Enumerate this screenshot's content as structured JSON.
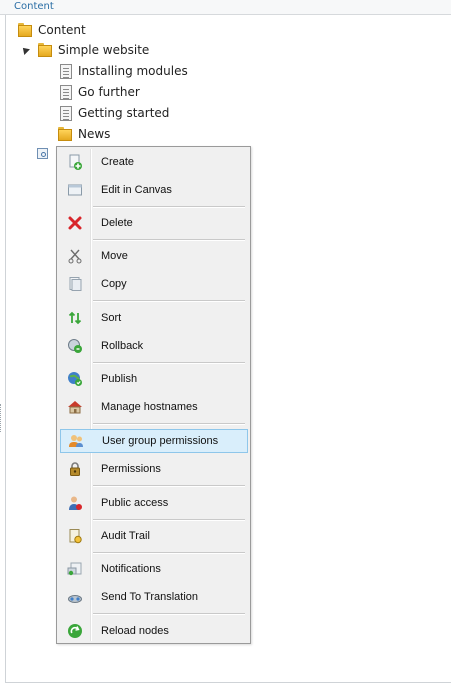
{
  "header": {
    "title": "Content"
  },
  "tree": {
    "root": {
      "label": "Content"
    },
    "site": {
      "label": "Simple website"
    },
    "pages": [
      {
        "label": "Installing modules"
      },
      {
        "label": "Go further"
      },
      {
        "label": "Getting started"
      }
    ],
    "news": {
      "label": "News"
    }
  },
  "context_menu": {
    "items": [
      {
        "label": "Create",
        "icon": "create-icon"
      },
      {
        "label": "Edit in Canvas",
        "icon": "canvas-icon"
      },
      {
        "label": "Delete",
        "icon": "delete-icon"
      },
      {
        "label": "Move",
        "icon": "move-icon"
      },
      {
        "label": "Copy",
        "icon": "copy-icon"
      },
      {
        "label": "Sort",
        "icon": "sort-icon"
      },
      {
        "label": "Rollback",
        "icon": "rollback-icon"
      },
      {
        "label": "Publish",
        "icon": "publish-icon"
      },
      {
        "label": "Manage hostnames",
        "icon": "hostnames-icon"
      },
      {
        "label": "User group permissions",
        "icon": "user-group-icon"
      },
      {
        "label": "Permissions",
        "icon": "lock-icon"
      },
      {
        "label": "Public access",
        "icon": "public-access-icon"
      },
      {
        "label": "Audit Trail",
        "icon": "audit-icon"
      },
      {
        "label": "Notifications",
        "icon": "notification-icon"
      },
      {
        "label": "Send To Translation",
        "icon": "translation-icon"
      },
      {
        "label": "Reload nodes",
        "icon": "reload-icon"
      }
    ],
    "highlighted": "User group permissions"
  },
  "colors": {
    "header_text": "#2b6ea5",
    "menu_bg": "#f0f0f0",
    "highlight_bg": "#d9eefb",
    "highlight_border": "#8ec6ea"
  }
}
